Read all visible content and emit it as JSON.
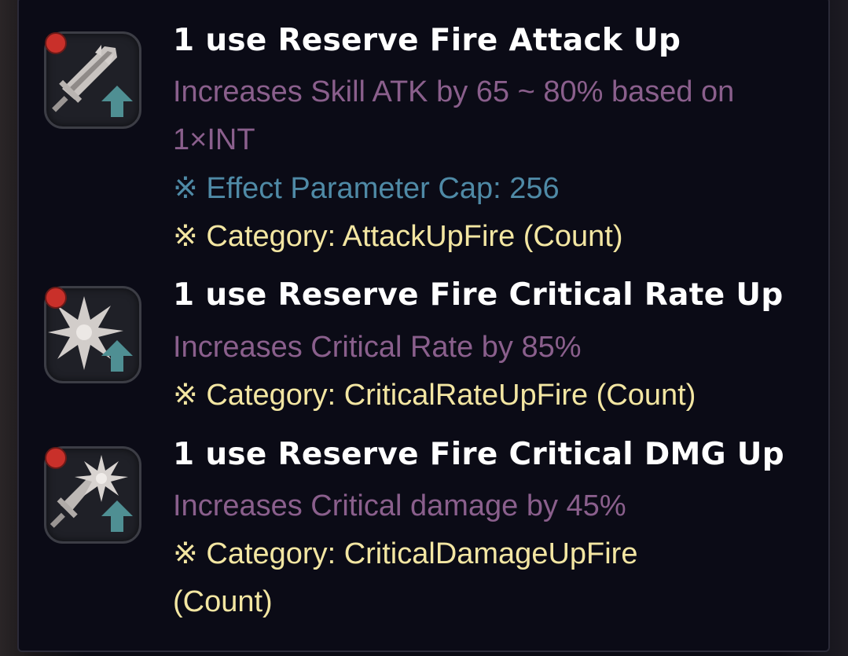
{
  "effects": [
    {
      "icon": "sword-attack-up-icon",
      "title": "1 use Reserve Fire Attack Up",
      "desc_lines": [
        "Increases Skill ATK by 65 ~ 80% based on",
        "1×INT"
      ],
      "cap": "※ Effect Parameter Cap: 256",
      "category_lines": [
        "※ Category: AttackUpFire (Count)"
      ]
    },
    {
      "icon": "starburst-critical-rate-up-icon",
      "title": "1 use Reserve Fire Critical Rate Up",
      "desc_lines": [
        "Increases Critical Rate by 85%"
      ],
      "category_lines": [
        "※ Category: CriticalRateUpFire (Count)"
      ]
    },
    {
      "icon": "sword-burst-critical-dmg-up-icon",
      "title": "1 use Reserve Fire Critical DMG Up",
      "desc_lines": [
        "Increases Critical damage by 45%"
      ],
      "category_lines": [
        "※ Category: CriticalDamageUpFire",
        "(Count)"
      ]
    }
  ],
  "colors": {
    "title": "#ffffff",
    "description": "#8a5f8c",
    "cap": "#4f8aa6",
    "category": "#f3e6a2",
    "fire_dot": "#c9302a",
    "up_arrow": "#4f8f93"
  }
}
